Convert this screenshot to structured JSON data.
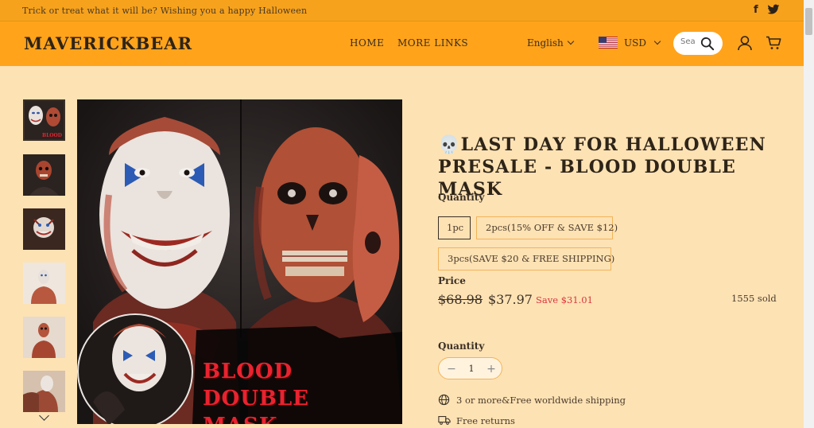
{
  "announcement": {
    "text": "Trick or treat what it will be? Wishing you a happy Halloween",
    "icons": [
      "facebook-icon",
      "twitter-icon"
    ]
  },
  "header": {
    "logo": "MAVERICKBEAR",
    "nav": [
      {
        "label": "HOME"
      },
      {
        "label": "MORE LINKS"
      }
    ],
    "language": "English",
    "currency": "USD",
    "search_placeholder": "Sea",
    "icons": [
      "search-icon",
      "user-icon",
      "cart-icon"
    ]
  },
  "gallery": {
    "thumbnail_count": 6,
    "main_banner_line1": "BLOOD DOUBLE",
    "main_banner_line2": "MASK"
  },
  "product": {
    "title": "💀LAST DAY FOR HALLOWEEN PRESALE - BLOOD DOUBLE MASK",
    "quantity_label": "Quantity",
    "options": [
      {
        "label": "1pc",
        "selected": true
      },
      {
        "label": "2pcs(15% OFF & SAVE $12)",
        "selected": false
      },
      {
        "label": "3pcs(SAVE $20 & FREE SHIPPING)",
        "selected": false
      }
    ],
    "price_label": "Price",
    "old_price": "$68.98",
    "new_price": "$37.97",
    "save": "Save $31.01",
    "sold": "1555 sold",
    "quantity_label_2": "Quantity",
    "quantity_value": "1",
    "features": [
      {
        "icon": "globe-icon",
        "text": "3 or more&Free worldwide shipping"
      },
      {
        "icon": "truck-icon",
        "text": "Free returns"
      }
    ]
  },
  "colors": {
    "announcement_bg": "#f7a21c",
    "header_bg": "#ffa31b",
    "page_bg": "#fde2b4",
    "save_red": "#d9363e",
    "option_border": "#f2b45a"
  }
}
